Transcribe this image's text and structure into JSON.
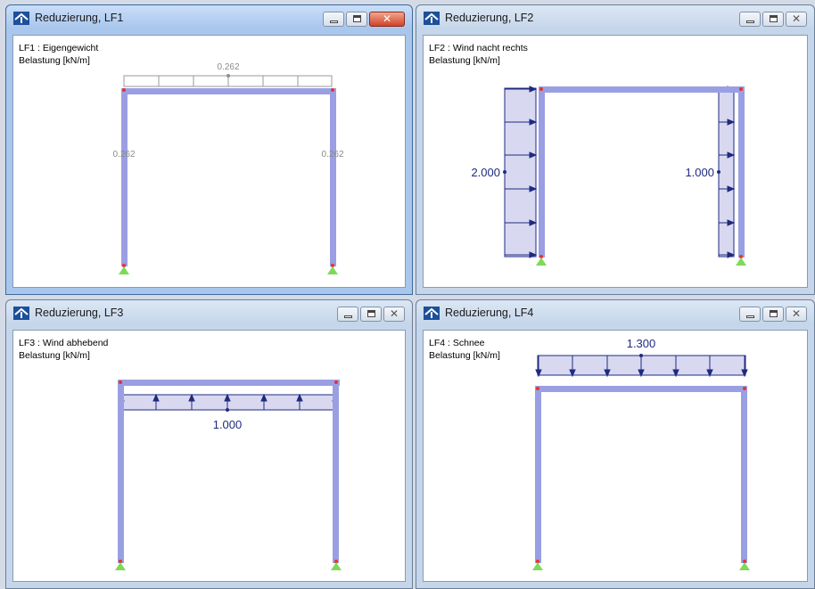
{
  "windows": [
    {
      "title": "Reduzierung, LF1",
      "case": "LF1 : Eigengewicht",
      "unit": "Belastung [kN/m]",
      "values": {
        "beam": "0.262",
        "left": "0.262",
        "right": "0.262"
      }
    },
    {
      "title": "Reduzierung, LF2",
      "case": "LF2 : Wind nacht rechts",
      "unit": "Belastung [kN/m]",
      "values": {
        "left": "2.000",
        "right": "1.000"
      }
    },
    {
      "title": "Reduzierung, LF3",
      "case": "LF3 : Wind abhebend",
      "unit": "Belastung [kN/m]",
      "values": {
        "beam": "1.000"
      }
    },
    {
      "title": "Reduzierung, LF4",
      "case": "LF4 : Schnee",
      "unit": "Belastung [kN/m]",
      "values": {
        "beam": "1.300"
      }
    }
  ],
  "icons": [
    "app-icon",
    "minimize-icon",
    "maximize-icon",
    "close-icon"
  ],
  "colors": {
    "member": "#9a9fe3",
    "load_fill": "#d8d9f0",
    "load_line": "#1f2a80",
    "support": "#7ed957",
    "node": "#e8332b",
    "grey_load": "#8f8f8f"
  }
}
